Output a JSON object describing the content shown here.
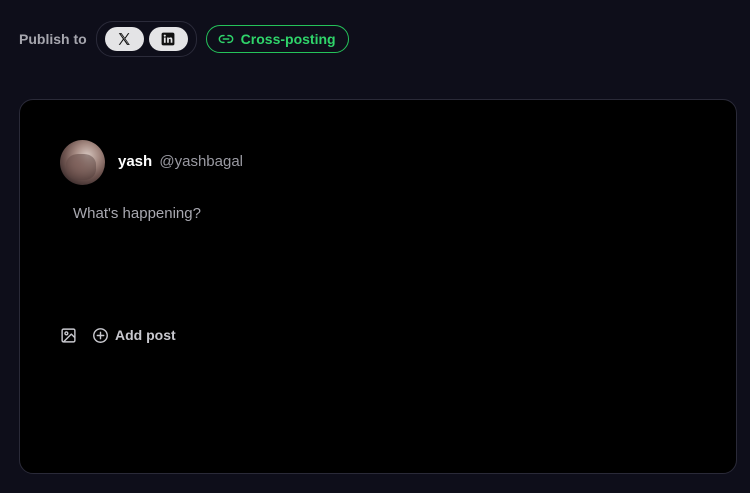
{
  "publish": {
    "label": "Publish to",
    "platforms": [
      {
        "name": "x-icon"
      },
      {
        "name": "linkedin-icon"
      }
    ]
  },
  "crosspost": {
    "label": "Cross-posting",
    "icon": "link-icon",
    "color": "#2fd46a"
  },
  "composer": {
    "user_name": "yash",
    "user_handle": "@yashbagal",
    "placeholder": "What's happening?",
    "add_post_label": "Add post",
    "media_icon": "image-icon",
    "add_icon": "plus-circle-icon"
  }
}
